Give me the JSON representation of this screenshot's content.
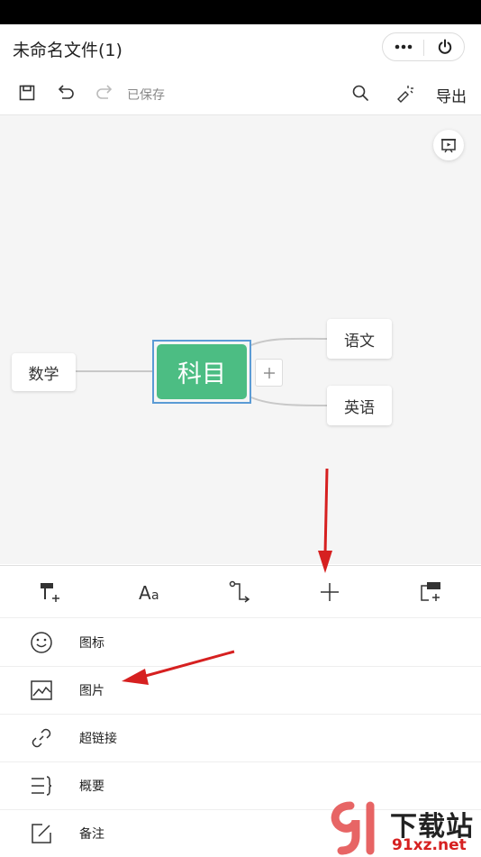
{
  "window": {
    "title": "未命名文件(1)"
  },
  "capsule": {
    "more_icon": "more-dots-icon",
    "close_icon": "power-icon"
  },
  "toolbar": {
    "saved_status": "已保存",
    "export_label": "导出"
  },
  "mindmap": {
    "root": "科目",
    "left_child": "数学",
    "right_children": [
      "语文",
      "英语"
    ]
  },
  "bottom_tabs": [
    "style-icon",
    "font-icon",
    "connector-icon",
    "add-icon",
    "subtopic-icon"
  ],
  "insert_menu": {
    "items": [
      {
        "label": "图标",
        "icon": "smiley-icon"
      },
      {
        "label": "图片",
        "icon": "image-icon"
      },
      {
        "label": "超链接",
        "icon": "link-icon"
      },
      {
        "label": "概要",
        "icon": "summary-icon"
      },
      {
        "label": "备注",
        "icon": "note-icon"
      }
    ]
  },
  "watermark": {
    "text": "下载站",
    "domain": "91xz.net"
  },
  "colors": {
    "root_node": "#4cbd83",
    "selection": "#5b9bd5",
    "arrow": "#d62020",
    "canvas": "#f5f5f5"
  }
}
